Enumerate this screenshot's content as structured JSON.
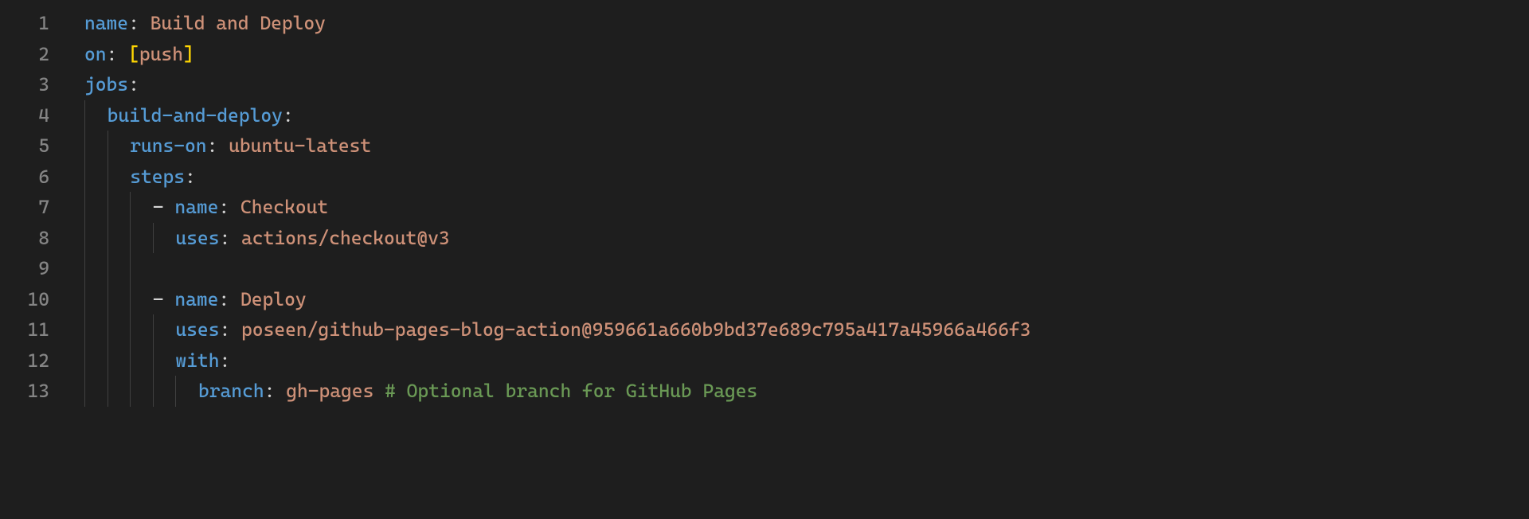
{
  "editor": {
    "lineCount": 13,
    "indentUnit": 2,
    "indentPx": 28.6,
    "lines": [
      {
        "indent": 0,
        "guides": [],
        "tokens": [
          {
            "t": "name",
            "c": "key"
          },
          {
            "t": ":",
            "c": "punc"
          },
          {
            "t": " ",
            "c": "plain"
          },
          {
            "t": "Build and Deploy",
            "c": "str"
          }
        ]
      },
      {
        "indent": 0,
        "guides": [],
        "tokens": [
          {
            "t": "on",
            "c": "key"
          },
          {
            "t": ":",
            "c": "punc"
          },
          {
            "t": " ",
            "c": "plain"
          },
          {
            "t": "[",
            "c": "brack"
          },
          {
            "t": "push",
            "c": "str"
          },
          {
            "t": "]",
            "c": "brack"
          }
        ]
      },
      {
        "indent": 0,
        "guides": [],
        "tokens": [
          {
            "t": "jobs",
            "c": "key"
          },
          {
            "t": ":",
            "c": "punc"
          }
        ]
      },
      {
        "indent": 1,
        "guides": [
          0
        ],
        "tokens": [
          {
            "t": "build-and-deploy",
            "c": "key"
          },
          {
            "t": ":",
            "c": "punc"
          }
        ]
      },
      {
        "indent": 2,
        "guides": [
          0,
          1
        ],
        "tokens": [
          {
            "t": "runs-on",
            "c": "key"
          },
          {
            "t": ":",
            "c": "punc"
          },
          {
            "t": " ",
            "c": "plain"
          },
          {
            "t": "ubuntu-latest",
            "c": "str"
          }
        ]
      },
      {
        "indent": 2,
        "guides": [
          0,
          1
        ],
        "tokens": [
          {
            "t": "steps",
            "c": "key"
          },
          {
            "t": ":",
            "c": "punc"
          }
        ]
      },
      {
        "indent": 3,
        "guides": [
          0,
          1,
          2
        ],
        "tokens": [
          {
            "t": "- ",
            "c": "plain"
          },
          {
            "t": "name",
            "c": "key"
          },
          {
            "t": ":",
            "c": "punc"
          },
          {
            "t": " ",
            "c": "plain"
          },
          {
            "t": "Checkout",
            "c": "str"
          }
        ]
      },
      {
        "indent": 4,
        "guides": [
          0,
          1,
          2,
          3
        ],
        "tokens": [
          {
            "t": "uses",
            "c": "key"
          },
          {
            "t": ":",
            "c": "punc"
          },
          {
            "t": " ",
            "c": "plain"
          },
          {
            "t": "actions/checkout@v3",
            "c": "str"
          }
        ]
      },
      {
        "indent": 0,
        "guides": [
          0,
          1,
          2
        ],
        "tokens": []
      },
      {
        "indent": 3,
        "guides": [
          0,
          1,
          2
        ],
        "tokens": [
          {
            "t": "- ",
            "c": "plain"
          },
          {
            "t": "name",
            "c": "key"
          },
          {
            "t": ":",
            "c": "punc"
          },
          {
            "t": " ",
            "c": "plain"
          },
          {
            "t": "Deploy",
            "c": "str"
          }
        ]
      },
      {
        "indent": 4,
        "guides": [
          0,
          1,
          2,
          3
        ],
        "tokens": [
          {
            "t": "uses",
            "c": "key"
          },
          {
            "t": ":",
            "c": "punc"
          },
          {
            "t": " ",
            "c": "plain"
          },
          {
            "t": "poseen/github-pages-blog-action@959661a660b9bd37e689c795a417a45966a466f3",
            "c": "str"
          }
        ]
      },
      {
        "indent": 4,
        "guides": [
          0,
          1,
          2,
          3
        ],
        "tokens": [
          {
            "t": "with",
            "c": "key"
          },
          {
            "t": ":",
            "c": "punc"
          }
        ]
      },
      {
        "indent": 5,
        "guides": [
          0,
          1,
          2,
          3,
          4
        ],
        "tokens": [
          {
            "t": "branch",
            "c": "key"
          },
          {
            "t": ":",
            "c": "punc"
          },
          {
            "t": " ",
            "c": "plain"
          },
          {
            "t": "gh-pages",
            "c": "str"
          },
          {
            "t": " ",
            "c": "plain"
          },
          {
            "t": "# Optional branch for GitHub Pages",
            "c": "comment"
          }
        ]
      }
    ]
  }
}
